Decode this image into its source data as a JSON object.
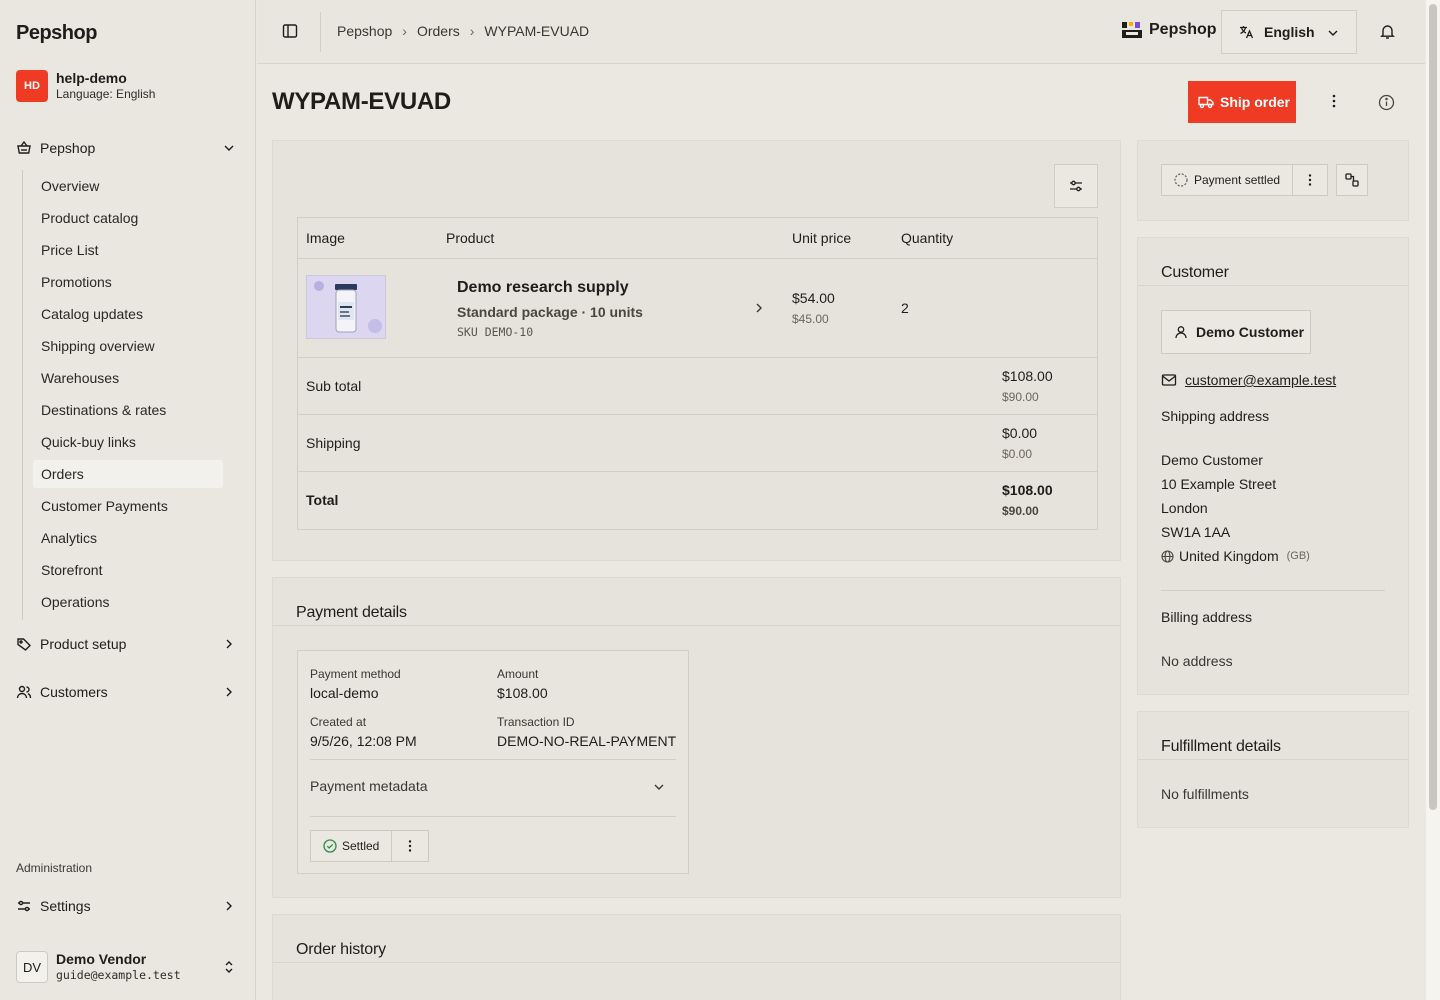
{
  "sidebar": {
    "brand": "Pepshop",
    "account": {
      "initials": "HD",
      "name": "help-demo",
      "language": "Language: English"
    },
    "group_pepshop": "Pepshop",
    "items": [
      "Overview",
      "Product catalog",
      "Price List",
      "Promotions",
      "Catalog updates",
      "Shipping overview",
      "Warehouses",
      "Destinations & rates",
      "Quick-buy links",
      "Orders",
      "Customer Payments",
      "Analytics",
      "Storefront",
      "Operations"
    ],
    "active_item": "Orders",
    "group_product_setup": "Product setup",
    "group_customers": "Customers",
    "admin_label": "Administration",
    "settings": "Settings",
    "vendor": {
      "initials": "DV",
      "name": "Demo Vendor",
      "email": "guide@example.test"
    }
  },
  "topbar": {
    "breadcrumb": [
      "Pepshop",
      "Orders",
      "WYPAM-EVUAD"
    ],
    "brand": "Pepshop",
    "language": "English"
  },
  "header": {
    "title": "WYPAM-EVUAD",
    "ship_label": "Ship order"
  },
  "products": {
    "headers": {
      "image": "Image",
      "product": "Product",
      "unit_price": "Unit price",
      "quantity": "Quantity"
    },
    "item": {
      "name": "Demo research supply",
      "variant": "Standard package · 10 units",
      "sku": "SKU DEMO-10",
      "unit_price": "$54.00",
      "unit_price_sub": "$45.00",
      "quantity": "2"
    },
    "subtotal": {
      "label": "Sub total",
      "value": "$108.00",
      "sub": "$90.00"
    },
    "shipping": {
      "label": "Shipping",
      "value": "$0.00",
      "sub": "$0.00"
    },
    "total": {
      "label": "Total",
      "value": "$108.00",
      "sub": "$90.00"
    }
  },
  "payment": {
    "title": "Payment details",
    "method_label": "Payment method",
    "method": "local-demo",
    "amount_label": "Amount",
    "amount": "$108.00",
    "created_label": "Created at",
    "created": "9/5/26, 12:08 PM",
    "txn_label": "Transaction ID",
    "txn": "DEMO-NO-REAL-PAYMENT",
    "metadata_label": "Payment metadata",
    "state": "Settled"
  },
  "history": {
    "title": "Order history"
  },
  "status": {
    "label": "Payment settled"
  },
  "customer": {
    "title": "Customer",
    "name": "Demo Customer",
    "email": "customer@example.test",
    "shipping_title": "Shipping address",
    "address": [
      "Demo Customer",
      "10 Example Street",
      "London",
      "SW1A 1AA"
    ],
    "country": "United Kingdom",
    "country_code": "(GB)",
    "billing_title": "Billing address",
    "billing_empty": "No address"
  },
  "fulfillment": {
    "title": "Fulfillment details",
    "empty": "No fulfillments"
  },
  "colors": {
    "accent": "#ef3b24",
    "background": "#ebe8e1",
    "card": "#e6e3dc"
  }
}
